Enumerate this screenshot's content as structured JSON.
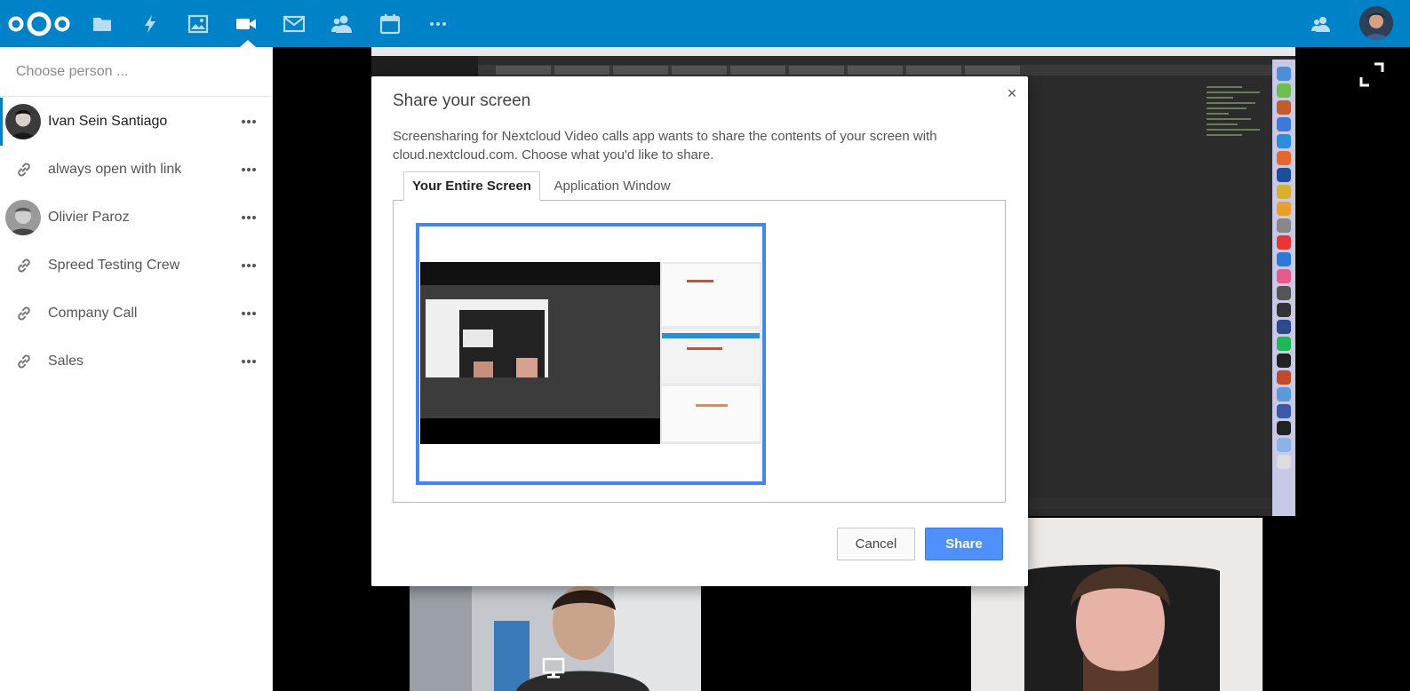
{
  "colors": {
    "brand": "#0082c9",
    "accent": "#4d90fe",
    "stage_background": "#000000"
  },
  "header": {
    "logo": "nextcloud-logo",
    "apps": [
      {
        "name": "files",
        "icon": "folder-icon",
        "active": false
      },
      {
        "name": "activity",
        "icon": "lightning-icon",
        "active": false
      },
      {
        "name": "gallery",
        "icon": "image-icon",
        "active": false
      },
      {
        "name": "talk",
        "icon": "video-camera-icon",
        "active": true
      },
      {
        "name": "mail",
        "icon": "envelope-icon",
        "active": false
      },
      {
        "name": "contacts",
        "icon": "contacts-icon",
        "active": false
      },
      {
        "name": "calendar",
        "icon": "calendar-icon",
        "active": false
      },
      {
        "name": "more",
        "icon": "more-icon",
        "active": false
      }
    ],
    "right": {
      "contacts_menu_icon": "contacts-menu-icon",
      "user_avatar": "user-avatar"
    }
  },
  "sidebar": {
    "search": {
      "placeholder": "Choose person ...",
      "value": ""
    },
    "conversations": [
      {
        "label": "Ivan Sein Santiago",
        "kind": "avatar",
        "active": true
      },
      {
        "label": "always open with link",
        "kind": "link",
        "active": false
      },
      {
        "label": "Olivier Paroz",
        "kind": "avatar",
        "active": false
      },
      {
        "label": "Spreed Testing Crew",
        "kind": "link",
        "active": false
      },
      {
        "label": "Company Call",
        "kind": "link",
        "active": false
      },
      {
        "label": "Sales",
        "kind": "link",
        "active": false
      }
    ],
    "more_icon": "more-horizontal-icon"
  },
  "dialog": {
    "title": "Share your screen",
    "description": "Screensharing for Nextcloud Video calls app wants to share the contents of your screen with cloud.nextcloud.com. Choose what you'd like to share.",
    "tabs": [
      {
        "label": "Your Entire Screen",
        "active": true
      },
      {
        "label": "Application Window",
        "active": false
      }
    ],
    "cancel_label": "Cancel",
    "share_label": "Share",
    "close_symbol": "×"
  }
}
